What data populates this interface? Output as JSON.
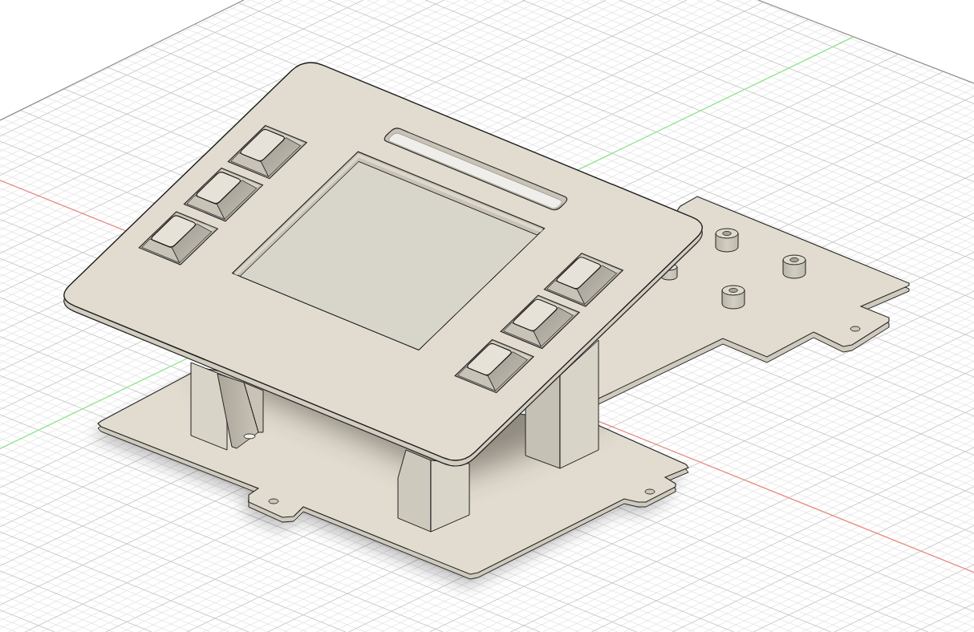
{
  "viewport": {
    "axes": [
      {
        "color": "#ec8f88"
      },
      {
        "color": "#8fe98f"
      }
    ]
  }
}
